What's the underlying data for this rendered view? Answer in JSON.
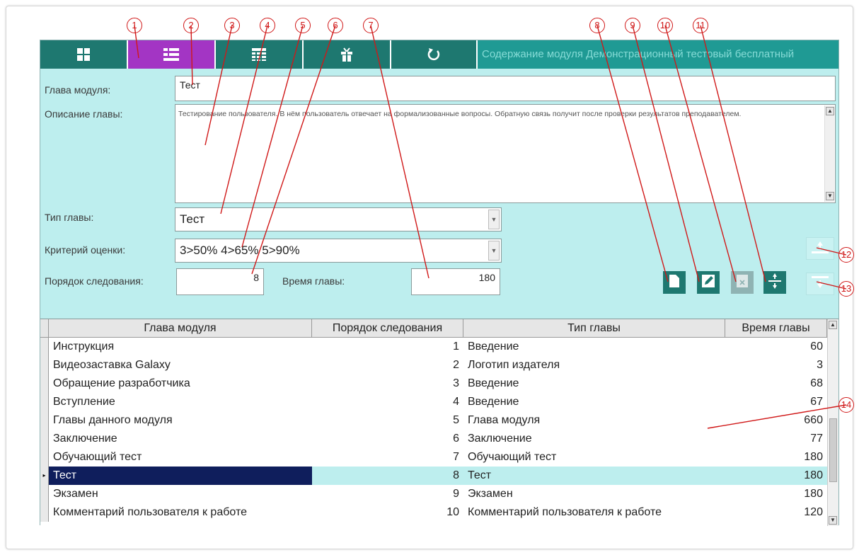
{
  "topbar": {
    "title": "Содержание модуля Демонстрационный тестовый бесплатный",
    "tabs": [
      {
        "icon": "tiles-icon"
      },
      {
        "icon": "list-icon",
        "active": true
      },
      {
        "icon": "table-icon"
      },
      {
        "icon": "gift-icon"
      },
      {
        "icon": "refresh-icon"
      }
    ]
  },
  "form": {
    "chapter_label": "Глава модуля:",
    "chapter_value": "Тест",
    "description_label": "Описание главы:",
    "description_value": "Тестирование пользователя. В нём пользователь отвечает на формализованные вопросы. Обратную связь получит после проверки результатов преподавателем.",
    "type_label": "Тип главы:",
    "type_value": "Тест",
    "criteria_label": "Критерий оценки:",
    "criteria_value": "3>50% 4>65% 5>90%",
    "order_label": "Порядок следования:",
    "order_value": "8",
    "time_label": "Время главы:",
    "time_value": "180"
  },
  "actions": [
    "new-page-icon",
    "edit-pencil-icon",
    "delete-icon",
    "expand-icon"
  ],
  "side_buttons": [
    "move-up-icon",
    "move-down-icon"
  ],
  "grid": {
    "columns": [
      "Глава модуля",
      "Порядок следования",
      "Тип главы",
      "Время главы"
    ],
    "rows": [
      [
        "Инструкция",
        "1",
        "Введение",
        "60"
      ],
      [
        "Видеозаставка Galaxy",
        "2",
        "Логотип издателя",
        "3"
      ],
      [
        "Обращение разработчика",
        "3",
        "Введение",
        "68"
      ],
      [
        "Вступление",
        "4",
        "Введение",
        "67"
      ],
      [
        "Главы данного модуля",
        "5",
        "Глава модуля",
        "660"
      ],
      [
        "Заключение",
        "6",
        "Заключение",
        "77"
      ],
      [
        "Обучающий тест",
        "7",
        "Обучающий тест",
        "180"
      ],
      [
        "Тест",
        "8",
        "Тест",
        "180"
      ],
      [
        "Экзамен",
        "9",
        "Экзамен",
        "180"
      ],
      [
        "Комментарий пользователя к работе",
        "10",
        "Комментарий пользователя к работе",
        "120"
      ]
    ],
    "selected_row": 7
  },
  "callouts": [
    "1",
    "2",
    "3",
    "4",
    "5",
    "6",
    "7",
    "8",
    "9",
    "10",
    "11",
    "12",
    "13",
    "14"
  ],
  "colors": {
    "panel_bg": "#bdeeee",
    "tab_teal": "#1e7870",
    "tab_active": "#a335c4",
    "selection_navy": "#0f1e5c",
    "callout_red": "#d01818"
  }
}
